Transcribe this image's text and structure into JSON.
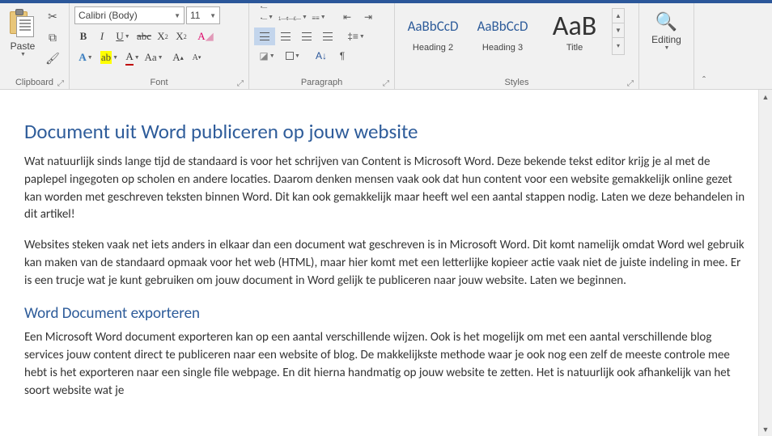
{
  "ribbon": {
    "clipboard": {
      "paste": "Paste",
      "label": "Clipboard"
    },
    "font": {
      "name": "Calibri (Body)",
      "size": "11",
      "label": "Font"
    },
    "paragraph": {
      "label": "Paragraph"
    },
    "styles": {
      "label": "Styles",
      "items": [
        {
          "preview": "AaBbCcD",
          "name": "Heading 2"
        },
        {
          "preview": "AaBbCcD",
          "name": "Heading 3"
        },
        {
          "preview": "AaB",
          "name": "Title"
        }
      ]
    },
    "editing": {
      "label": "Editing"
    }
  },
  "document": {
    "h1": "Document uit Word publiceren op jouw website",
    "p1": "Wat natuurlijk sinds lange tijd de standaard is voor het schrijven van Content is Microsoft Word. Deze bekende tekst editor krijg je al met de paplepel ingegoten op scholen en andere locaties. Daarom denken mensen vaak ook dat hun content voor een website gemakkelijk online gezet kan worden met geschreven teksten binnen Word. Dit kan ook gemakkelijk maar heeft wel een aantal stappen nodig. Laten we deze behandelen in dit artikel!",
    "p2": "Websites steken vaak net iets anders in elkaar dan een document wat geschreven is in Microsoft Word. Dit komt namelijk omdat Word wel gebruik kan maken van de standaard opmaak voor het web (HTML), maar hier komt met een letterlijke kopieer actie vaak niet de juiste indeling in mee. Er is een trucje wat je kunt gebruiken om jouw document in Word gelijk te publiceren naar jouw website. Laten we beginnen.",
    "h2": "Word Document exporteren",
    "p3": "Een Microsoft Word document exporteren kan op een aantal verschillende wijzen. Ook is het mogelijk om met een aantal verschillende blog services jouw content direct te publiceren naar een website of blog. De makkelijkste methode waar je ook nog een zelf de meeste controle mee hebt is het exporteren naar een single file webpage. En dit hierna handmatig op jouw website te zetten. Het is natuurlijk ook afhankelijk van het soort website wat je"
  }
}
